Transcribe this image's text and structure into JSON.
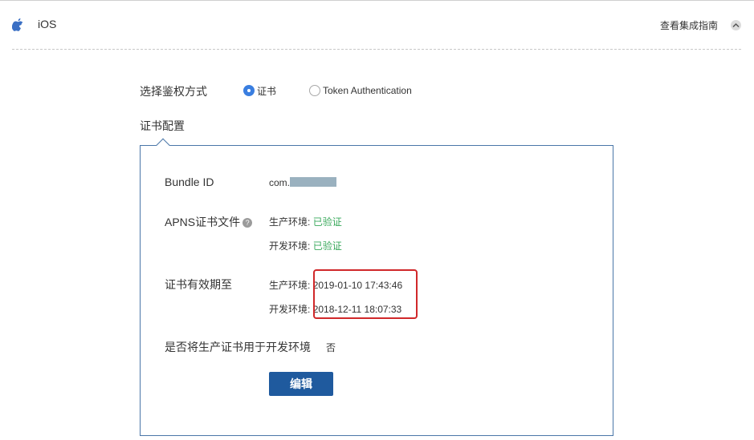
{
  "header": {
    "platform_title": "iOS",
    "guide_link": "查看集成指南",
    "icons": {
      "platform": "apple-icon",
      "collapse": "chevron-up-icon"
    }
  },
  "auth": {
    "label": "选择鉴权方式",
    "options": [
      {
        "label": "证书",
        "selected": true
      },
      {
        "label": "Token Authentication",
        "selected": false
      }
    ]
  },
  "cert_config": {
    "title": "证书配置",
    "bundle_id": {
      "label": "Bundle ID",
      "value_prefix": "com."
    },
    "apns": {
      "label": "APNS证书文件",
      "help": "?",
      "prod_label": "生产环境:",
      "prod_status": "已验证",
      "dev_label": "开发环境:",
      "dev_status": "已验证"
    },
    "expiry": {
      "label": "证书有效期至",
      "prod_label": "生产环境:",
      "prod_date": "2019-01-10 17:43:46",
      "dev_label": "开发环境:",
      "dev_date": "2018-12-11 18:07:33"
    },
    "use_prod_for_dev": {
      "label": "是否将生产证书用于开发环境",
      "value": "否"
    },
    "edit_button": "编辑"
  },
  "colors": {
    "accent": "#3a7ee0",
    "panel_border": "#4a76a8",
    "verified_green": "#3aa95c",
    "highlight_red": "#d0282a",
    "button_blue": "#1f5a9e"
  }
}
